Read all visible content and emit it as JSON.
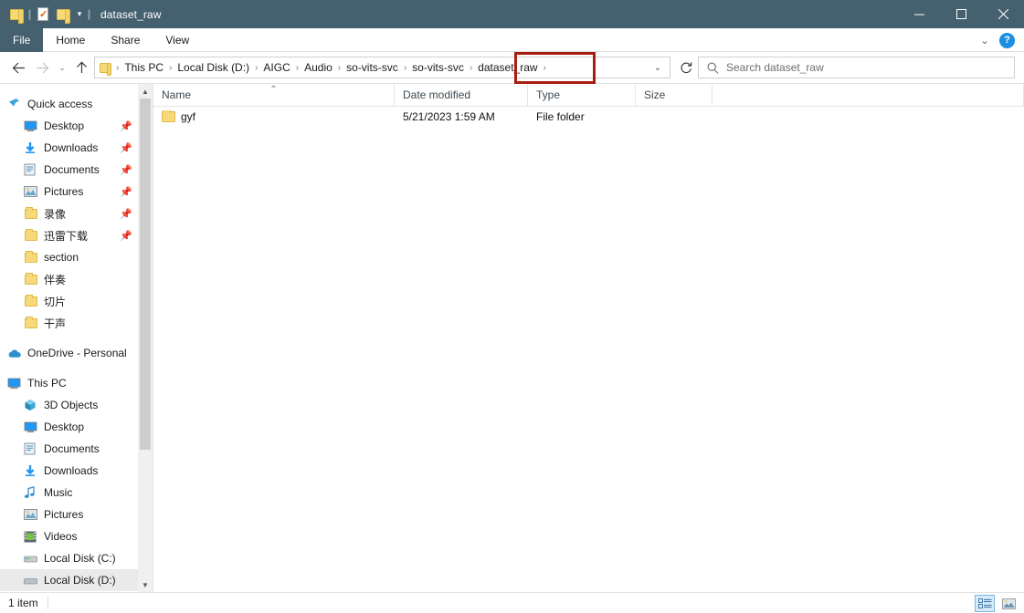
{
  "window": {
    "title": "dataset_raw",
    "quick_access_toolbar": [
      {
        "name": "folder-icon",
        "label": "Folder"
      },
      {
        "name": "properties-icon",
        "label": "Properties"
      },
      {
        "name": "new-folder-icon",
        "label": "New folder"
      },
      {
        "name": "customize-caret-icon",
        "label": "Customize Quick Access Toolbar"
      }
    ],
    "controls": {
      "minimize": "Minimize",
      "maximize": "Maximize",
      "close": "Close"
    }
  },
  "ribbon": {
    "tabs": [
      {
        "label": "File"
      },
      {
        "label": "Home"
      },
      {
        "label": "Share"
      },
      {
        "label": "View"
      }
    ],
    "expand_label": "Expand the Ribbon",
    "help_label": "?"
  },
  "nav": {
    "back": "Back",
    "forward": "Forward",
    "recent": "Recent locations",
    "up": "Up"
  },
  "address": {
    "crumbs": [
      "This PC",
      "Local Disk (D:)",
      "AIGC",
      "Audio",
      "so-vits-svc",
      "so-vits-svc",
      "dataset_raw"
    ],
    "separator": "›",
    "dropdown": "Previous locations",
    "refresh": "Refresh",
    "highlight_color": "#a81e10",
    "highlighted_crumb": "dataset_raw"
  },
  "search": {
    "placeholder": "Search dataset_raw",
    "icon": "search-icon"
  },
  "sidebar": {
    "sections": [
      {
        "name": "quick-access",
        "header": {
          "label": "Quick access",
          "icon": "star-pin-icon"
        },
        "items": [
          {
            "label": "Desktop",
            "icon": "desktop-icon",
            "pinned": true
          },
          {
            "label": "Downloads",
            "icon": "downloads-icon",
            "pinned": true
          },
          {
            "label": "Documents",
            "icon": "documents-icon",
            "pinned": true
          },
          {
            "label": "Pictures",
            "icon": "pictures-icon",
            "pinned": true
          },
          {
            "label": "录像",
            "icon": "folder-icon",
            "pinned": true
          },
          {
            "label": "迅雷下载",
            "icon": "folder-icon",
            "pinned": true
          },
          {
            "label": "section",
            "icon": "folder-icon",
            "pinned": false
          },
          {
            "label": "伴奏",
            "icon": "folder-icon",
            "pinned": false
          },
          {
            "label": "切片",
            "icon": "folder-icon",
            "pinned": false
          },
          {
            "label": "干声",
            "icon": "folder-icon",
            "pinned": false
          }
        ]
      },
      {
        "name": "onedrive",
        "header": {
          "label": "OneDrive - Personal",
          "icon": "cloud-icon"
        },
        "items": []
      },
      {
        "name": "this-pc",
        "header": {
          "label": "This PC",
          "icon": "this-pc-icon"
        },
        "items": [
          {
            "label": "3D Objects",
            "icon": "3d-objects-icon",
            "pinned": false
          },
          {
            "label": "Desktop",
            "icon": "desktop-icon",
            "pinned": false
          },
          {
            "label": "Documents",
            "icon": "documents-icon",
            "pinned": false
          },
          {
            "label": "Downloads",
            "icon": "downloads-icon",
            "pinned": false
          },
          {
            "label": "Music",
            "icon": "music-icon",
            "pinned": false
          },
          {
            "label": "Pictures",
            "icon": "pictures-icon",
            "pinned": false
          },
          {
            "label": "Videos",
            "icon": "videos-icon",
            "pinned": false
          },
          {
            "label": "Local Disk (C:)",
            "icon": "drive-icon",
            "pinned": false
          },
          {
            "label": "Local Disk (D:)",
            "icon": "drive-icon",
            "pinned": false
          }
        ]
      }
    ]
  },
  "filelist": {
    "columns": [
      {
        "label": "Name",
        "sorted": "asc",
        "sort_caret": "⌃"
      },
      {
        "label": "Date modified",
        "sorted": null
      },
      {
        "label": "Type",
        "sorted": null
      },
      {
        "label": "Size",
        "sorted": null
      }
    ],
    "rows": [
      {
        "name": "gyf",
        "date_modified": "5/21/2023 1:59 AM",
        "type": "File folder",
        "size": "",
        "icon": "folder-icon"
      }
    ]
  },
  "statusbar": {
    "item_count": "1 item",
    "views": [
      {
        "name": "details-view-button",
        "label": "Details",
        "active": true
      },
      {
        "name": "large-icons-view-button",
        "label": "Large icons",
        "active": false
      }
    ]
  }
}
